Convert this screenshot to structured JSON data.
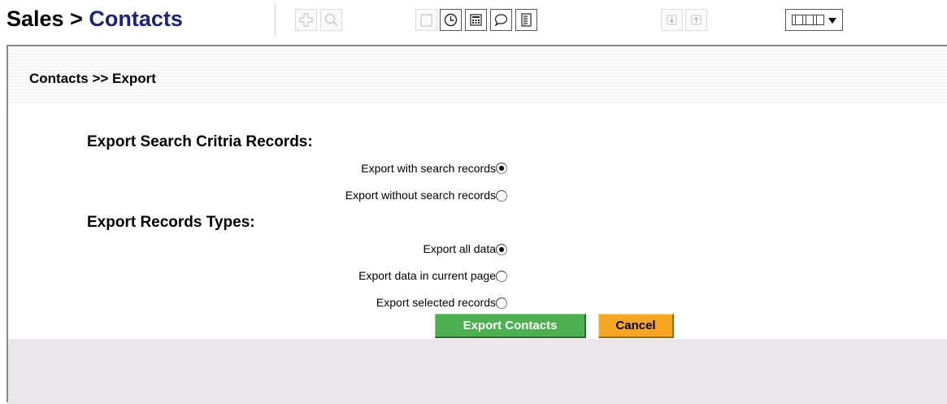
{
  "header": {
    "title_part1": "Sales",
    "title_sep": " > ",
    "title_part2": "Contacts"
  },
  "toolbar": {
    "icons": [
      "add-icon",
      "search-icon",
      "notes-icon",
      "clock-icon",
      "calculator-icon",
      "comment-icon",
      "document-icon",
      "move-down-icon",
      "move-up-icon",
      "column-view-icon"
    ]
  },
  "panel": {
    "breadcrumb": "Contacts >> Export"
  },
  "sections": {
    "search_criteria": {
      "heading": "Export Search Critria Records:",
      "options": [
        {
          "label": "Export with search records",
          "selected": true
        },
        {
          "label": "Export without search records",
          "selected": false
        }
      ]
    },
    "record_types": {
      "heading": "Export Records Types:",
      "options": [
        {
          "label": "Export all data",
          "selected": true
        },
        {
          "label": "Export data in current page",
          "selected": false
        },
        {
          "label": "Export selected records",
          "selected": false
        }
      ]
    }
  },
  "actions": {
    "export_label": "Export Contacts",
    "cancel_label": "Cancel"
  },
  "colors": {
    "export_button": "#4caf50",
    "cancel_button": "#f5a623",
    "title_accent": "#1a237e",
    "footer_bg": "#eae6ea"
  }
}
